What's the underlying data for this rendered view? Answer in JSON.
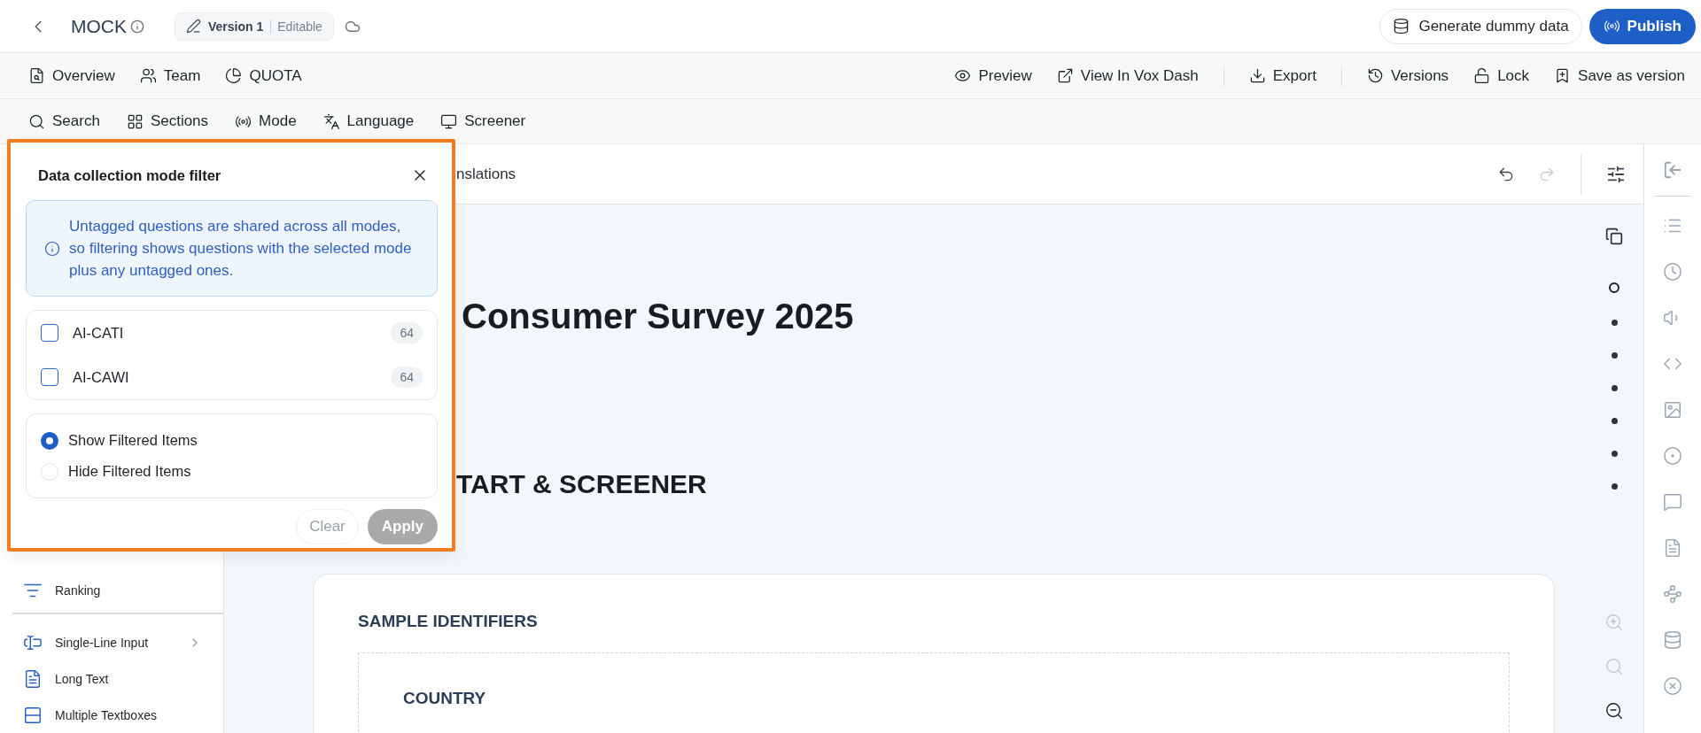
{
  "header": {
    "title": "MOCK",
    "version": {
      "label": "Version 1",
      "status": "Editable"
    },
    "generate": "Generate dummy data",
    "publish": "Publish"
  },
  "nav": {
    "left": [
      "Overview",
      "Team",
      "QUOTA"
    ],
    "right": [
      [
        "Preview",
        "View In Vox Dash"
      ],
      [
        "Export"
      ],
      [
        "Versions",
        "Lock",
        "Save as version"
      ]
    ]
  },
  "toolbar": [
    "Search",
    "Sections",
    "Mode",
    "Language",
    "Screener"
  ],
  "sidebar": {
    "groups": [
      [
        {
          "label": "Ranking",
          "expandable": false
        }
      ],
      [
        {
          "label": "Single-Line Input",
          "expandable": true
        },
        {
          "label": "Long Text",
          "expandable": false
        },
        {
          "label": "Multiple Textboxes",
          "expandable": false
        }
      ]
    ]
  },
  "canvas": {
    "tab": "nslations",
    "undo": {
      "disabled": false
    },
    "redo": {
      "disabled": true
    },
    "title": "Consumer Survey 2025",
    "section": "TART & SCREENER",
    "card": {
      "title": "SAMPLE IDENTIFIERS",
      "field": "COUNTRY"
    },
    "outline": [
      {
        "selected": true
      },
      {
        "selected": false
      },
      {
        "selected": false
      },
      {
        "selected": false
      },
      {
        "selected": false
      },
      {
        "selected": false
      },
      {
        "selected": false
      }
    ],
    "zoom": [
      {
        "disabled": true
      },
      {
        "disabled": true
      },
      {
        "disabled": false
      }
    ]
  },
  "filter": {
    "title": "Data collection mode filter",
    "info": "Untagged questions are shared across all modes, so filtering shows questions with the selected mode plus any untagged ones.",
    "modes": [
      {
        "label": "AI-CATI",
        "count": "64",
        "checked": false
      },
      {
        "label": "AI-CAWI",
        "count": "64",
        "checked": false
      }
    ],
    "display": [
      {
        "label": "Show Filtered Items",
        "selected": true
      },
      {
        "label": "Hide Filtered Items",
        "selected": false
      }
    ],
    "clear": "Clear",
    "apply": {
      "label": "Apply",
      "disabled": true
    }
  }
}
